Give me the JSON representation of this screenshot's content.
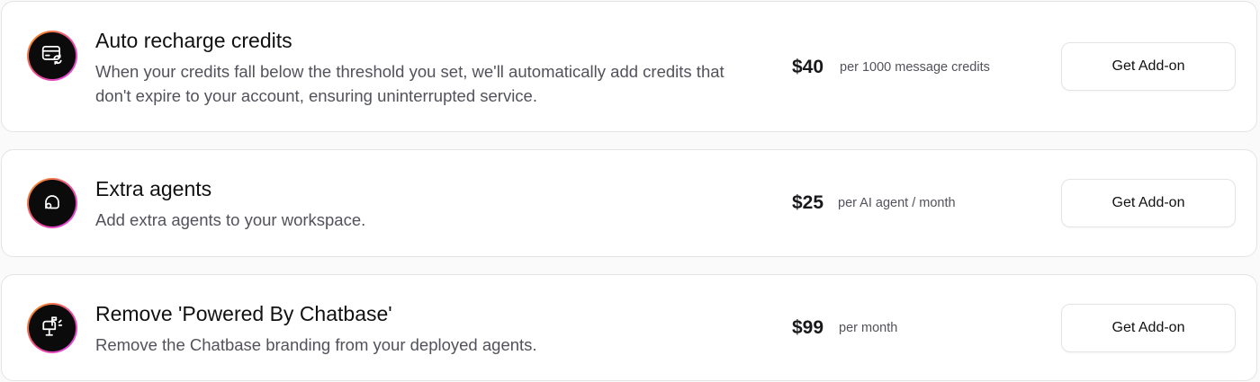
{
  "addons": [
    {
      "icon": "credit-card-refresh-icon",
      "title": "Auto recharge credits",
      "description": "When your credits fall below the threshold you set, we'll automatically add credits that don't expire to your account, ensuring uninterrupted service.",
      "price": "$40",
      "unit": "per 1000 message credits",
      "button_label": "Get Add-on"
    },
    {
      "icon": "agent-icon",
      "title": "Extra agents",
      "description": "Add extra agents to your workspace.",
      "price": "$25",
      "unit": "per AI agent / month",
      "button_label": "Get Add-on"
    },
    {
      "icon": "mailbox-icon",
      "title": "Remove 'Powered By Chatbase'",
      "description": "Remove the Chatbase branding from your deployed agents.",
      "price": "$99",
      "unit": "per month",
      "button_label": "Get Add-on"
    }
  ]
}
